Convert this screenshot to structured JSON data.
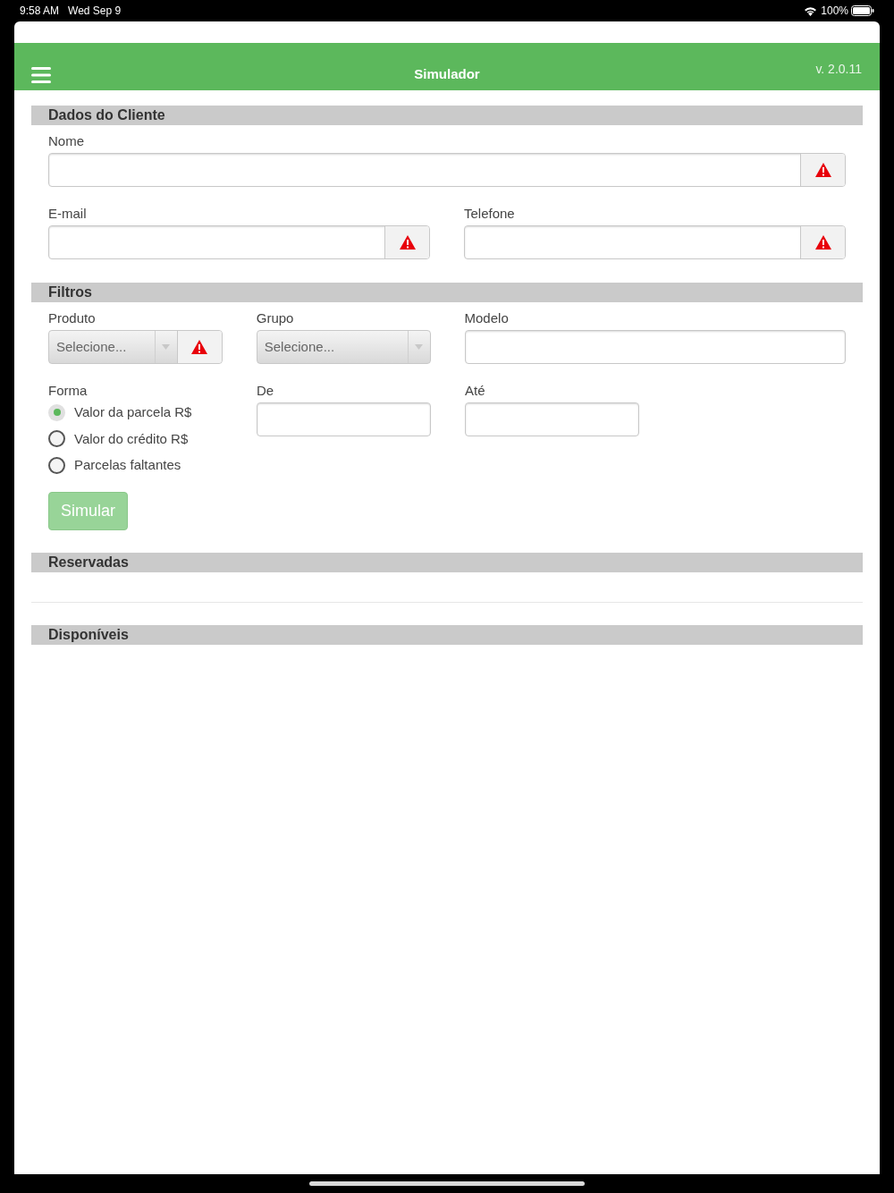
{
  "status_bar": {
    "time": "9:58 AM",
    "date": "Wed Sep 9",
    "battery": "100%"
  },
  "header": {
    "title": "Simulador",
    "version": "v. 2.0.11"
  },
  "cliente": {
    "title": "Dados do Cliente",
    "nome": {
      "label": "Nome",
      "warning": true
    },
    "email": {
      "label": "E-mail",
      "warning": true
    },
    "telefone": {
      "label": "Telefone",
      "warning": true
    }
  },
  "filtros": {
    "title": "Filtros",
    "produto": {
      "label": "Produto",
      "placeholder": "Selecione...",
      "warning": true
    },
    "grupo": {
      "label": "Grupo",
      "placeholder": "Selecione...",
      "warning": false
    },
    "modelo": {
      "label": "Modelo"
    },
    "forma": {
      "label": "Forma",
      "options": [
        {
          "label": "Valor da parcela R$",
          "selected": true
        },
        {
          "label": "Valor do crédito R$",
          "selected": false
        },
        {
          "label": "Parcelas faltantes",
          "selected": false
        }
      ]
    },
    "de": {
      "label": "De"
    },
    "ate": {
      "label": "Até"
    },
    "button": {
      "label": "Simular",
      "disabled": true
    }
  },
  "reservadas": {
    "title": "Reservadas"
  },
  "disponiveis": {
    "title": "Disponíveis"
  }
}
